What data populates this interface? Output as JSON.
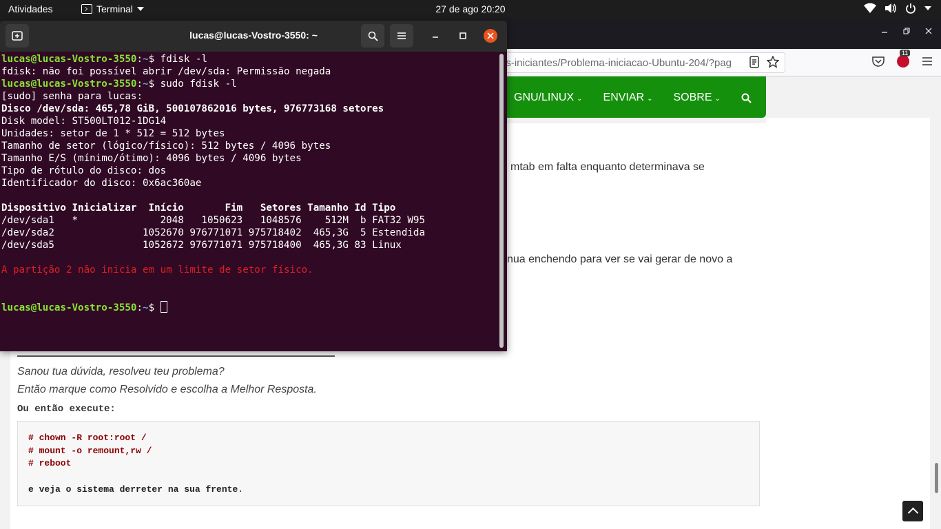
{
  "topbar": {
    "activities": "Atividades",
    "app_name": "Terminal",
    "clock": "27 de ago  20:20"
  },
  "browser": {
    "url": "os-iniciantes/Problema-iniciacao-Ubuntu-204/?pag",
    "abp_badge": "11",
    "site_nav": {
      "items": [
        {
          "label": "GNU/LINUX",
          "caret": "⌄"
        },
        {
          "label": "ENVIAR",
          "caret": "⌄"
        },
        {
          "label": "SOBRE",
          "caret": "⌄"
        }
      ]
    },
    "post": {
      "line1": "mtab em falta enquanto determinava se",
      "line2": "nua enchendo para ver se vai gerar de novo a",
      "signature_1": "Sanou tua dúvida, resolveu teu problema?",
      "signature_2": "Então marque como Resolvido e escolha a Melhor Resposta.",
      "ou_entao": "Ou então execute:",
      "code": [
        "# chown -R root:root /",
        "# mount -o remount,rw /",
        "# reboot"
      ],
      "closing": "e veja o sistema derreter na sua frente",
      "closing_dot": "."
    }
  },
  "terminal": {
    "title": "lucas@lucas-Vostro-3550: ~",
    "prompt_user": "lucas@lucas-Vostro-3550",
    "prompt_sep": ":",
    "prompt_path": "~",
    "prompt_end": "$",
    "cmd1": " fdisk -l",
    "out1": "fdisk: não foi possível abrir /dev/sda: Permissão negada",
    "cmd2": " sudo fdisk -l",
    "sudo_prompt": "[sudo] senha para lucas:",
    "disk_header": "Disco /dev/sda: 465,78 GiB, 500107862016 bytes, 976773168 setores",
    "info": [
      "Disk model: ST500LT012-1DG14",
      "Unidades: setor de 1 * 512 = 512 bytes",
      "Tamanho de setor (lógico/físico): 512 bytes / 4096 bytes",
      "Tamanho E/S (mínimo/ótimo): 4096 bytes / 4096 bytes",
      "Tipo de rótulo do disco: dos",
      "Identificador do disco: 0x6ac360ae"
    ],
    "table_header": "Dispositivo Inicializar  Início       Fim   Setores Tamanho Id Tipo",
    "table_rows": [
      "/dev/sda1   *              2048   1050623   1048576    512M  b FAT32 W95",
      "/dev/sda2               1052670 976771071 975718402  465,3G  5 Estendida",
      "/dev/sda5               1052672 976771071 975718400  465,3G 83 Linux"
    ],
    "warning": "A partição 2 não inicia em um limite de setor físico.",
    "final_prompt_suffix": " "
  }
}
